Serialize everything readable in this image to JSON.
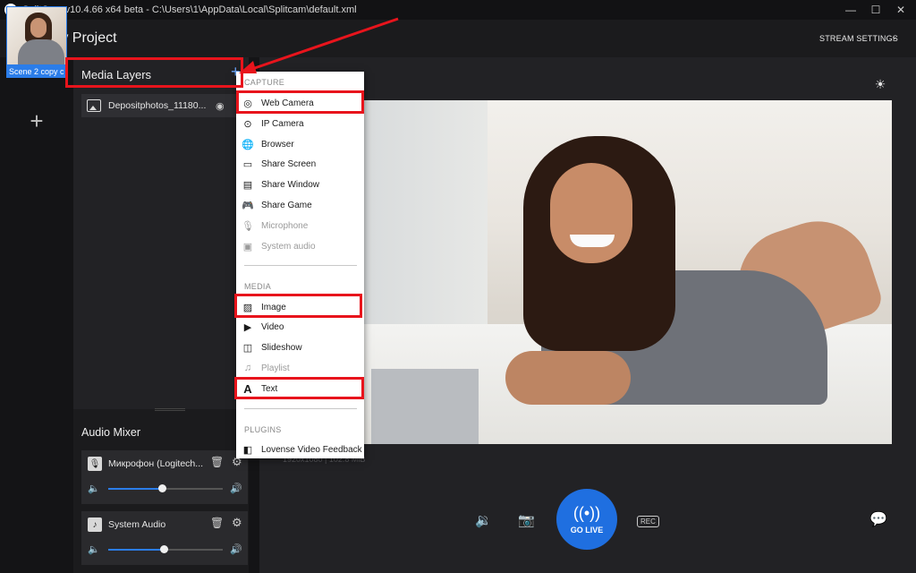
{
  "window": {
    "title": "SplitCam v10.4.66 x64 beta - C:\\Users\\1\\AppData\\Local\\Splitcam\\default.xml",
    "minimize": "—",
    "maximize": "☐",
    "close": "✕"
  },
  "header": {
    "project_title": "My Project",
    "stream_settings": "STREAM SETTINGS",
    "stream_settings_chevron": "⌄"
  },
  "scenes": {
    "items": [
      {
        "label": "Scene 2 copy c"
      }
    ],
    "add_label": "+"
  },
  "layers": {
    "title": "Media Layers",
    "add_label": "+",
    "items": [
      {
        "name": "Depositphotos_11180...",
        "icon": "image-icon",
        "visible": true
      }
    ]
  },
  "audio": {
    "title": "Audio Mixer",
    "channels": [
      {
        "name": "Микрофон  (Logitech...",
        "icon": "microphone-icon",
        "level": 0.47
      },
      {
        "name": "System Audio",
        "icon": "music-note-icon",
        "level": 0.48
      }
    ]
  },
  "preview": {
    "info": "1920x1080 | 102.8 MiB"
  },
  "controls": {
    "go_live": "GO LIVE",
    "go_live_icon": "((•))",
    "rec_label": "REC"
  },
  "menu": {
    "sections": [
      {
        "title": "CAPTURE",
        "items": [
          {
            "label": "Web Camera",
            "icon": "webcam-icon",
            "disabled": false
          },
          {
            "label": "IP Camera",
            "icon": "ip-camera-icon",
            "disabled": false
          },
          {
            "label": "Browser",
            "icon": "globe-icon",
            "disabled": false
          },
          {
            "label": "Share Screen",
            "icon": "screen-icon",
            "disabled": false
          },
          {
            "label": "Share Window",
            "icon": "window-icon",
            "disabled": false
          },
          {
            "label": "Share Game",
            "icon": "gamepad-icon",
            "disabled": false
          },
          {
            "label": "Microphone",
            "icon": "microphone-icon",
            "disabled": true
          },
          {
            "label": "System audio",
            "icon": "speaker-icon",
            "disabled": true
          }
        ]
      },
      {
        "title": "MEDIA",
        "items": [
          {
            "label": "Image",
            "icon": "image-icon",
            "disabled": false
          },
          {
            "label": "Video",
            "icon": "video-icon",
            "disabled": false
          },
          {
            "label": "Slideshow",
            "icon": "slideshow-icon",
            "disabled": false
          },
          {
            "label": "Playlist",
            "icon": "playlist-icon",
            "disabled": true
          },
          {
            "label": "Text",
            "icon": "text-icon",
            "disabled": false
          }
        ]
      },
      {
        "title": "PLUGINS",
        "items": [
          {
            "label": "Lovense Video Feedback",
            "icon": "plugin-icon",
            "disabled": false
          }
        ]
      }
    ]
  },
  "colors": {
    "accent": "#2b7de9",
    "go_live": "#1f6fe0",
    "annotation": "#e8141c"
  }
}
